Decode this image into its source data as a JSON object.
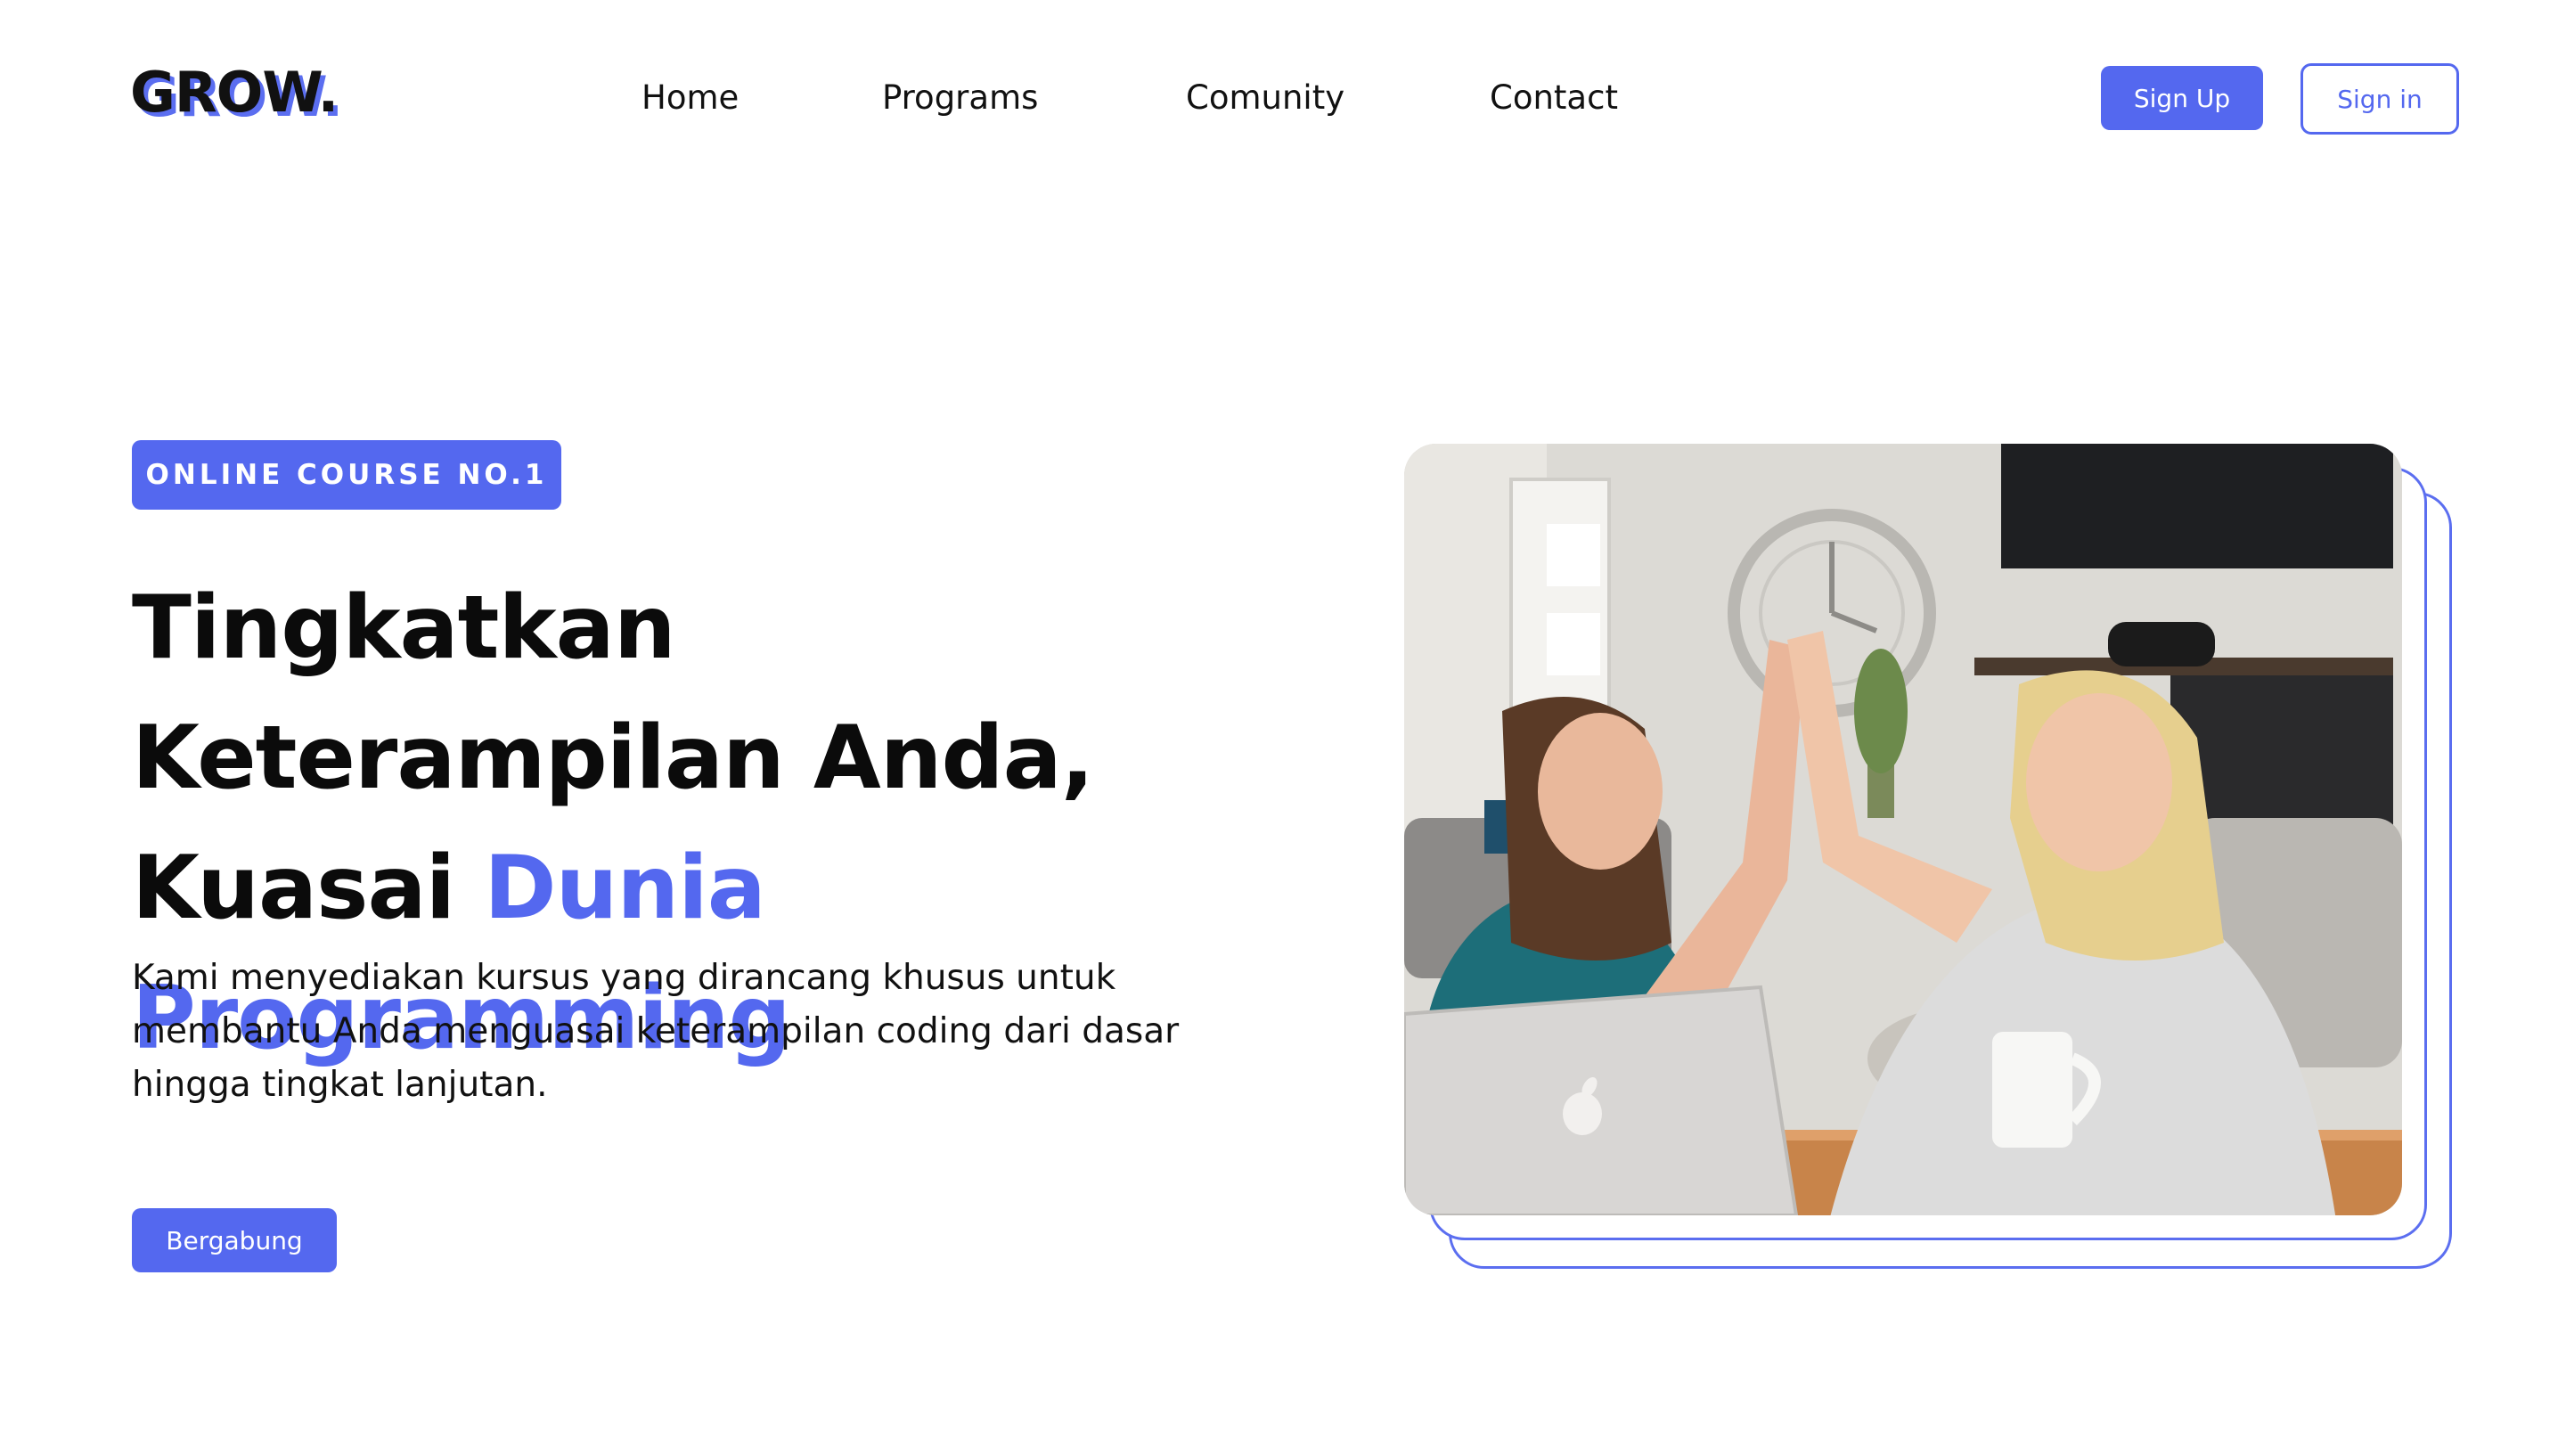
{
  "brand": {
    "logo_text": "GROW.",
    "accent_color": "#5468ef"
  },
  "nav": {
    "links": [
      "Home",
      "Programs",
      "Comunity",
      "Contact"
    ]
  },
  "auth": {
    "signup_label": "Sign Up",
    "signin_label": "Sign in"
  },
  "hero": {
    "badge": "ONLINE COURSE NO.1",
    "headline_part1": "Tingkatkan Keterampilan Anda, Kuasai ",
    "headline_accent": "Dunia Programming",
    "description": "Kami menyediakan kursus yang dirancang khusus untuk membantu Anda menguasai keterampilan coding dari dasar hingga tingkat lanjutan.",
    "cta_label": "Bergabung"
  },
  "image": {
    "icon": "laptop-apple-logo-icon"
  }
}
